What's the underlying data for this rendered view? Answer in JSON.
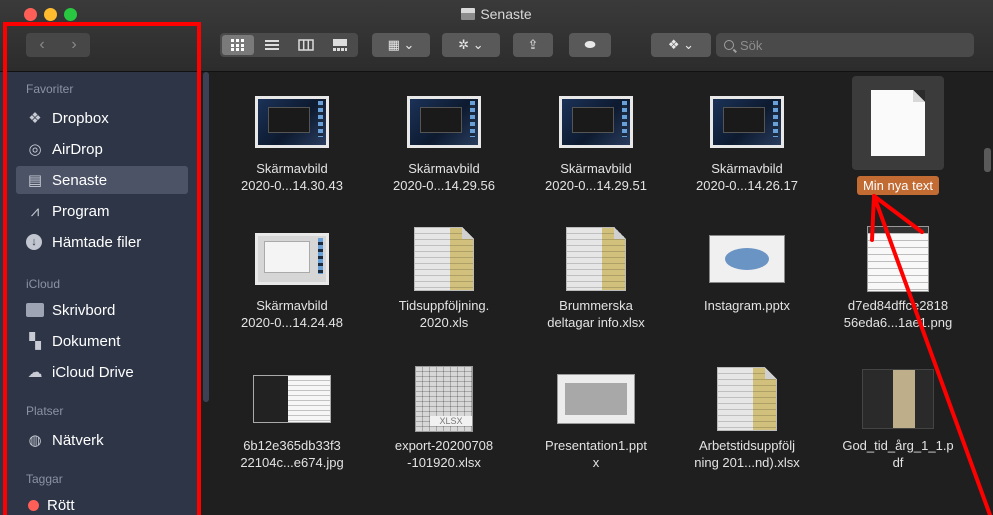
{
  "window": {
    "title": "Senaste"
  },
  "toolbar": {
    "back_glyph": "‹",
    "forward_glyph": "›",
    "view_icons": [
      "grid-view-icon",
      "list-view-icon",
      "column-view-icon",
      "gallery-view-icon"
    ],
    "arrange_glyph": "▦ ⌄",
    "action_glyph": "✲ ⌄",
    "share_glyph": "⇪",
    "tag_glyph": "⬬",
    "dropbox_glyph": "❖ ⌄",
    "search_placeholder": "Sök"
  },
  "sidebar": {
    "sections": [
      {
        "heading": "Favoriter",
        "items": [
          {
            "label": "Dropbox",
            "icon": "dropbox-icon",
            "glyph": "❖"
          },
          {
            "label": "AirDrop",
            "icon": "airdrop-icon",
            "glyph": "◎"
          },
          {
            "label": "Senaste",
            "icon": "recents-icon",
            "glyph": "▤",
            "selected": true
          },
          {
            "label": "Program",
            "icon": "applications-icon",
            "glyph": "⩘"
          },
          {
            "label": "Hämtade filer",
            "icon": "downloads-icon",
            "glyph": "↓"
          }
        ]
      },
      {
        "heading": "iCloud",
        "items": [
          {
            "label": "Skrivbord",
            "icon": "desktop-icon",
            "glyph": "▭"
          },
          {
            "label": "Dokument",
            "icon": "documents-icon",
            "glyph": "▚"
          },
          {
            "label": "iCloud Drive",
            "icon": "icloud-icon",
            "glyph": "☁"
          }
        ]
      },
      {
        "heading": "Platser",
        "items": [
          {
            "label": "Nätverk",
            "icon": "network-icon",
            "glyph": "◍"
          }
        ]
      },
      {
        "heading": "Taggar",
        "items": [
          {
            "label": "Rött",
            "icon": "red-tag-icon",
            "glyph": ""
          }
        ]
      }
    ]
  },
  "files": [
    {
      "line1": "Skärmavbild",
      "line2": "2020-0...14.30.43",
      "kind": "screenshot"
    },
    {
      "line1": "Skärmavbild",
      "line2": "2020-0...14.29.56",
      "kind": "screenshot"
    },
    {
      "line1": "Skärmavbild",
      "line2": "2020-0...14.29.51",
      "kind": "screenshot"
    },
    {
      "line1": "Skärmavbild",
      "line2": "2020-0...14.26.17",
      "kind": "screenshot"
    },
    {
      "line1": "Min nya text",
      "line2": "",
      "kind": "text-renaming"
    },
    {
      "line1": "Skärmavbild",
      "line2": "2020-0...14.24.48",
      "kind": "screenshot-light"
    },
    {
      "line1": "Tidsuppföljning.",
      "line2": "2020.xls",
      "kind": "spreadsheet"
    },
    {
      "line1": "Brummerska",
      "line2": "deltagar info.xlsx",
      "kind": "spreadsheet"
    },
    {
      "line1": "Instagram.pptx",
      "line2": "",
      "kind": "presentation"
    },
    {
      "line1": "d7ed84dffce2818",
      "line2": "56eda6...1ae1.png",
      "kind": "png"
    },
    {
      "line1": "6b12e365db33f3",
      "line2": "22104c...e674.jpg",
      "kind": "jpg"
    },
    {
      "line1": "export-20200708",
      "line2": "-101920.xlsx",
      "kind": "xlsx",
      "thumb_text": "XLSX"
    },
    {
      "line1": "Presentation1.ppt",
      "line2": "x",
      "kind": "presentation-grey"
    },
    {
      "line1": "Arbetstidsuppfölj",
      "line2": "ning 201...nd).xlsx",
      "kind": "spreadsheet"
    },
    {
      "line1": "God_tid_årg_1_1.p",
      "line2": "df",
      "kind": "pdf"
    }
  ],
  "colors": {
    "sidebar_bg": "#2d3547",
    "content_bg": "#1f1f1f",
    "rename_highlight": "#c26b33",
    "annotation_red": "#ff0000"
  }
}
